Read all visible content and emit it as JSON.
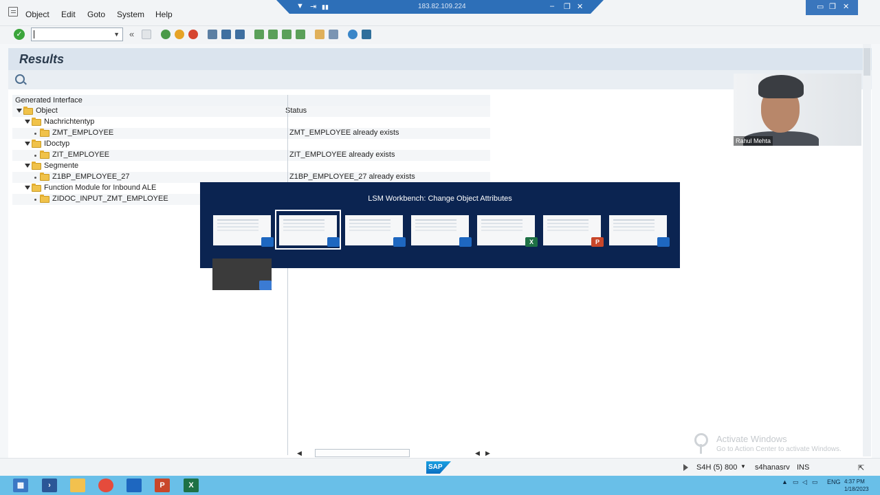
{
  "menubar": {
    "items": [
      "Object",
      "Edit",
      "Goto",
      "System",
      "Help"
    ]
  },
  "remote_session": {
    "host_ip": "183.82.109.224"
  },
  "toolbar": {
    "command_value": "",
    "prev_icon": "«"
  },
  "page": {
    "title": "Results"
  },
  "tree": {
    "column_header": "Generated Interface",
    "status_header": "Status",
    "rows": [
      {
        "label": "Object",
        "level": 0,
        "type": "folder-toggle",
        "status": ""
      },
      {
        "label": "Nachrichtentyp",
        "level": 1,
        "type": "folder-toggle",
        "status": ""
      },
      {
        "label": "ZMT_EMPLOYEE",
        "level": 2,
        "type": "leaf",
        "status": "ZMT_EMPLOYEE already exists"
      },
      {
        "label": "IDoctyp",
        "level": 1,
        "type": "folder-toggle",
        "status": ""
      },
      {
        "label": "ZIT_EMPLOYEE",
        "level": 2,
        "type": "leaf",
        "status": "ZIT_EMPLOYEE already exists"
      },
      {
        "label": "Segmente",
        "level": 1,
        "type": "folder-toggle",
        "status": ""
      },
      {
        "label": "Z1BP_EMPLOYEE_27",
        "level": 2,
        "type": "leaf",
        "status": "Z1BP_EMPLOYEE_27 already exists"
      },
      {
        "label": "Function Module for Inbound ALE",
        "level": 1,
        "type": "folder-toggle",
        "status": ""
      },
      {
        "label": "ZIDOC_INPUT_ZMT_EMPLOYEE",
        "level": 2,
        "type": "leaf",
        "status": ""
      }
    ]
  },
  "switcher": {
    "title": "LSM Workbench: Change Object Attributes",
    "selected_index": 1,
    "thumbnails": [
      {
        "app": "sap-gui",
        "badge": ""
      },
      {
        "app": "sap-gui",
        "badge": ""
      },
      {
        "app": "sap-gui",
        "badge": ""
      },
      {
        "app": "sap-gui",
        "badge": ""
      },
      {
        "app": "excel",
        "badge": "X"
      },
      {
        "app": "powerpoint",
        "badge": "P"
      },
      {
        "app": "sap-gui",
        "badge": ""
      },
      {
        "app": "remote-desktop",
        "badge": ""
      }
    ]
  },
  "webcam": {
    "name": "Rahul Mehta"
  },
  "watermark": {
    "title": "Activate Windows",
    "subtitle": "Go to Action Center to activate Windows."
  },
  "status_bar": {
    "sap_logo_text": "SAP",
    "system": "S4H (5) 800",
    "server": "s4hanasrv",
    "mode": "INS"
  },
  "taskbar": {
    "language": "ENG",
    "time": "4:37 PM",
    "date": "1/18/2023"
  },
  "colors": {
    "switcher_bg": "#0b2451",
    "taskbar_bg": "#69bfe8",
    "title_bg": "#dbe4ee",
    "folder": "#f0c24a"
  }
}
